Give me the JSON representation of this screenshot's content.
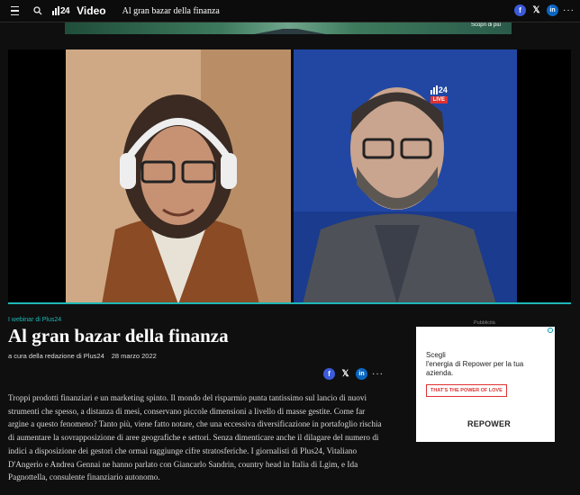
{
  "topbar": {
    "section": "Video",
    "page_title": "Al gran bazar della finanza",
    "logo_text": "24"
  },
  "ad_strip": {
    "text": "Scopri di più"
  },
  "video": {
    "live_label": "LIVE",
    "channel": "24",
    "progress": 1.0
  },
  "article": {
    "kicker": "I webinar di Plus24",
    "title": "Al gran bazar della finanza",
    "author": "a cura della redazione di Plus24",
    "date": "28 marzo 2022",
    "body": "Troppi prodotti finanziari e un marketing spinto. Il mondo del risparmio punta tantissimo sul lancio di nuovi strumenti che spesso, a distanza di mesi, conservano piccole dimensioni a livello di masse gestite. Come far argine a questo fenomeno? Tanto più, viene fatto notare, che una eccessiva diversificazione in portafoglio rischia di aumentare la sovrapposizione di aree geografiche e settori. Senza dimenticare anche il dilagare del numero di indici a disposizione dei gestori che ormai raggiunge cifre stratosferiche. I giornalisti di Plus24, Vitaliano D'Angerio e Andrea Gennai ne hanno parlato con Giancarlo Sandrin, country head in Italia di Lgim, e Ida Pagnottella, consulente finanziario autonomo."
  },
  "sidebar_ad": {
    "label": "Pubblicità",
    "line1": "Scegli",
    "line2": "l'energia di Repower per la tua azienda.",
    "cta": "THAT'S THE POWER OF LOVE",
    "brand_r": "̲R",
    "brand": "REPOWER"
  },
  "icons": {
    "menu": "menu-icon",
    "search": "search-icon",
    "facebook": "facebook-icon",
    "x": "x-icon",
    "linkedin": "linkedin-icon",
    "more": "more-icon"
  },
  "colors": {
    "accent": "#1fb7b7",
    "facebook": "#3b5bdb",
    "linkedin": "#0a66c2",
    "live": "#e03131"
  }
}
